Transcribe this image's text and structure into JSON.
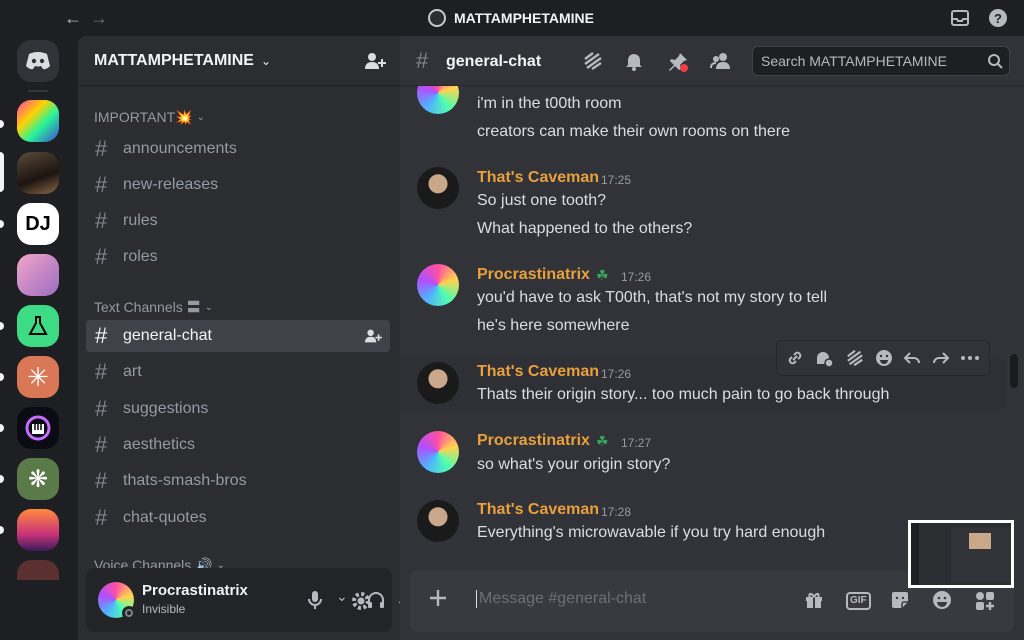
{
  "window": {
    "title": "MATTAMPHETAMINE"
  },
  "server": {
    "name": "MATTAMPHETAMINE"
  },
  "categories": {
    "important": "IMPORTANT💥",
    "text": "Text Channels 〓",
    "voice": "Voice Channels 🔊"
  },
  "important_channels": [
    "announcements",
    "new-releases",
    "rules",
    "roles"
  ],
  "text_channels": [
    "general-chat",
    "art",
    "suggestions",
    "aesthetics",
    "thats-smash-bros",
    "chat-quotes"
  ],
  "channel": {
    "name": "general-chat",
    "hash": "#"
  },
  "search": {
    "placeholder": "Search MATTAMPHETAMINE"
  },
  "messages": [
    {
      "lines": [
        "i'm in the t00th room",
        "creators can make their own rooms on there"
      ]
    },
    {
      "author": "That's Caveman",
      "time": "17:25",
      "lines": [
        "So just one tooth?",
        "What happened to the others?"
      ]
    },
    {
      "author": "Procrastinatrix",
      "time": "17:26",
      "lines": [
        "you'd have to ask T00th, that's not my story to tell",
        "he's here somewhere"
      ]
    },
    {
      "author": "That's Caveman",
      "time": "17:26",
      "lines": [
        "Thats their origin story... too much pain to go back through"
      ]
    },
    {
      "author": "Procrastinatrix",
      "time": "17:27",
      "lines": [
        "so what's your origin story?"
      ]
    },
    {
      "author": "That's Caveman",
      "time": "17:28",
      "lines": [
        "Everything's microwavable if you try hard enough"
      ]
    }
  ],
  "user": {
    "name": "Procrastinatrix",
    "status": "Invisible"
  },
  "composer": {
    "placeholder": "Message #general-chat",
    "gif_label": "GIF"
  },
  "guild_icons": {
    "dj_label": "DJ"
  },
  "colors": {
    "accent": "#5865f2",
    "author": "#e9a03c",
    "background": "#313338",
    "sidebar": "#2b2d31"
  }
}
